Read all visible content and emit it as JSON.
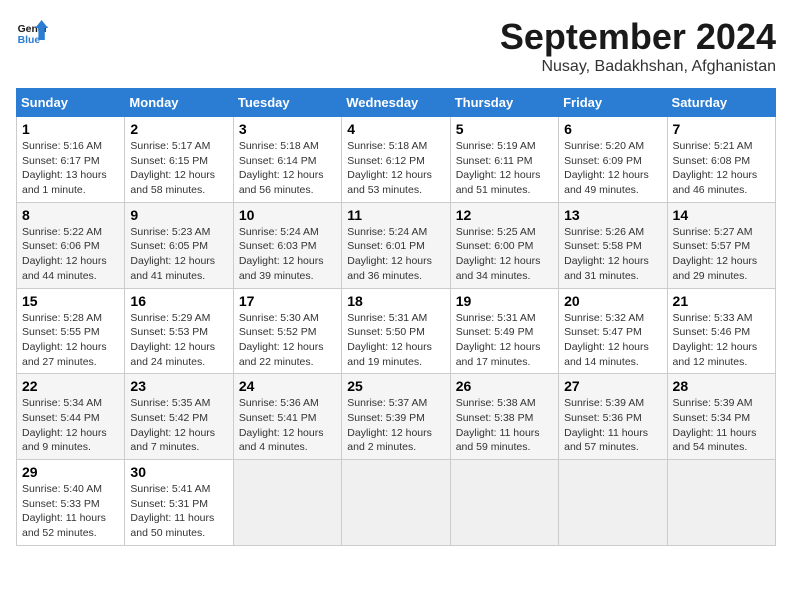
{
  "logo": {
    "line1": "General",
    "line2": "Blue"
  },
  "title": "September 2024",
  "location": "Nusay, Badakhshan, Afghanistan",
  "days_of_week": [
    "Sunday",
    "Monday",
    "Tuesday",
    "Wednesday",
    "Thursday",
    "Friday",
    "Saturday"
  ],
  "weeks": [
    [
      {
        "day": 1,
        "info": "Sunrise: 5:16 AM\nSunset: 6:17 PM\nDaylight: 13 hours\nand 1 minute."
      },
      {
        "day": 2,
        "info": "Sunrise: 5:17 AM\nSunset: 6:15 PM\nDaylight: 12 hours\nand 58 minutes."
      },
      {
        "day": 3,
        "info": "Sunrise: 5:18 AM\nSunset: 6:14 PM\nDaylight: 12 hours\nand 56 minutes."
      },
      {
        "day": 4,
        "info": "Sunrise: 5:18 AM\nSunset: 6:12 PM\nDaylight: 12 hours\nand 53 minutes."
      },
      {
        "day": 5,
        "info": "Sunrise: 5:19 AM\nSunset: 6:11 PM\nDaylight: 12 hours\nand 51 minutes."
      },
      {
        "day": 6,
        "info": "Sunrise: 5:20 AM\nSunset: 6:09 PM\nDaylight: 12 hours\nand 49 minutes."
      },
      {
        "day": 7,
        "info": "Sunrise: 5:21 AM\nSunset: 6:08 PM\nDaylight: 12 hours\nand 46 minutes."
      }
    ],
    [
      {
        "day": 8,
        "info": "Sunrise: 5:22 AM\nSunset: 6:06 PM\nDaylight: 12 hours\nand 44 minutes."
      },
      {
        "day": 9,
        "info": "Sunrise: 5:23 AM\nSunset: 6:05 PM\nDaylight: 12 hours\nand 41 minutes."
      },
      {
        "day": 10,
        "info": "Sunrise: 5:24 AM\nSunset: 6:03 PM\nDaylight: 12 hours\nand 39 minutes."
      },
      {
        "day": 11,
        "info": "Sunrise: 5:24 AM\nSunset: 6:01 PM\nDaylight: 12 hours\nand 36 minutes."
      },
      {
        "day": 12,
        "info": "Sunrise: 5:25 AM\nSunset: 6:00 PM\nDaylight: 12 hours\nand 34 minutes."
      },
      {
        "day": 13,
        "info": "Sunrise: 5:26 AM\nSunset: 5:58 PM\nDaylight: 12 hours\nand 31 minutes."
      },
      {
        "day": 14,
        "info": "Sunrise: 5:27 AM\nSunset: 5:57 PM\nDaylight: 12 hours\nand 29 minutes."
      }
    ],
    [
      {
        "day": 15,
        "info": "Sunrise: 5:28 AM\nSunset: 5:55 PM\nDaylight: 12 hours\nand 27 minutes."
      },
      {
        "day": 16,
        "info": "Sunrise: 5:29 AM\nSunset: 5:53 PM\nDaylight: 12 hours\nand 24 minutes."
      },
      {
        "day": 17,
        "info": "Sunrise: 5:30 AM\nSunset: 5:52 PM\nDaylight: 12 hours\nand 22 minutes."
      },
      {
        "day": 18,
        "info": "Sunrise: 5:31 AM\nSunset: 5:50 PM\nDaylight: 12 hours\nand 19 minutes."
      },
      {
        "day": 19,
        "info": "Sunrise: 5:31 AM\nSunset: 5:49 PM\nDaylight: 12 hours\nand 17 minutes."
      },
      {
        "day": 20,
        "info": "Sunrise: 5:32 AM\nSunset: 5:47 PM\nDaylight: 12 hours\nand 14 minutes."
      },
      {
        "day": 21,
        "info": "Sunrise: 5:33 AM\nSunset: 5:46 PM\nDaylight: 12 hours\nand 12 minutes."
      }
    ],
    [
      {
        "day": 22,
        "info": "Sunrise: 5:34 AM\nSunset: 5:44 PM\nDaylight: 12 hours\nand 9 minutes."
      },
      {
        "day": 23,
        "info": "Sunrise: 5:35 AM\nSunset: 5:42 PM\nDaylight: 12 hours\nand 7 minutes."
      },
      {
        "day": 24,
        "info": "Sunrise: 5:36 AM\nSunset: 5:41 PM\nDaylight: 12 hours\nand 4 minutes."
      },
      {
        "day": 25,
        "info": "Sunrise: 5:37 AM\nSunset: 5:39 PM\nDaylight: 12 hours\nand 2 minutes."
      },
      {
        "day": 26,
        "info": "Sunrise: 5:38 AM\nSunset: 5:38 PM\nDaylight: 11 hours\nand 59 minutes."
      },
      {
        "day": 27,
        "info": "Sunrise: 5:39 AM\nSunset: 5:36 PM\nDaylight: 11 hours\nand 57 minutes."
      },
      {
        "day": 28,
        "info": "Sunrise: 5:39 AM\nSunset: 5:34 PM\nDaylight: 11 hours\nand 54 minutes."
      }
    ],
    [
      {
        "day": 29,
        "info": "Sunrise: 5:40 AM\nSunset: 5:33 PM\nDaylight: 11 hours\nand 52 minutes."
      },
      {
        "day": 30,
        "info": "Sunrise: 5:41 AM\nSunset: 5:31 PM\nDaylight: 11 hours\nand 50 minutes."
      },
      {
        "day": null,
        "info": ""
      },
      {
        "day": null,
        "info": ""
      },
      {
        "day": null,
        "info": ""
      },
      {
        "day": null,
        "info": ""
      },
      {
        "day": null,
        "info": ""
      }
    ]
  ]
}
